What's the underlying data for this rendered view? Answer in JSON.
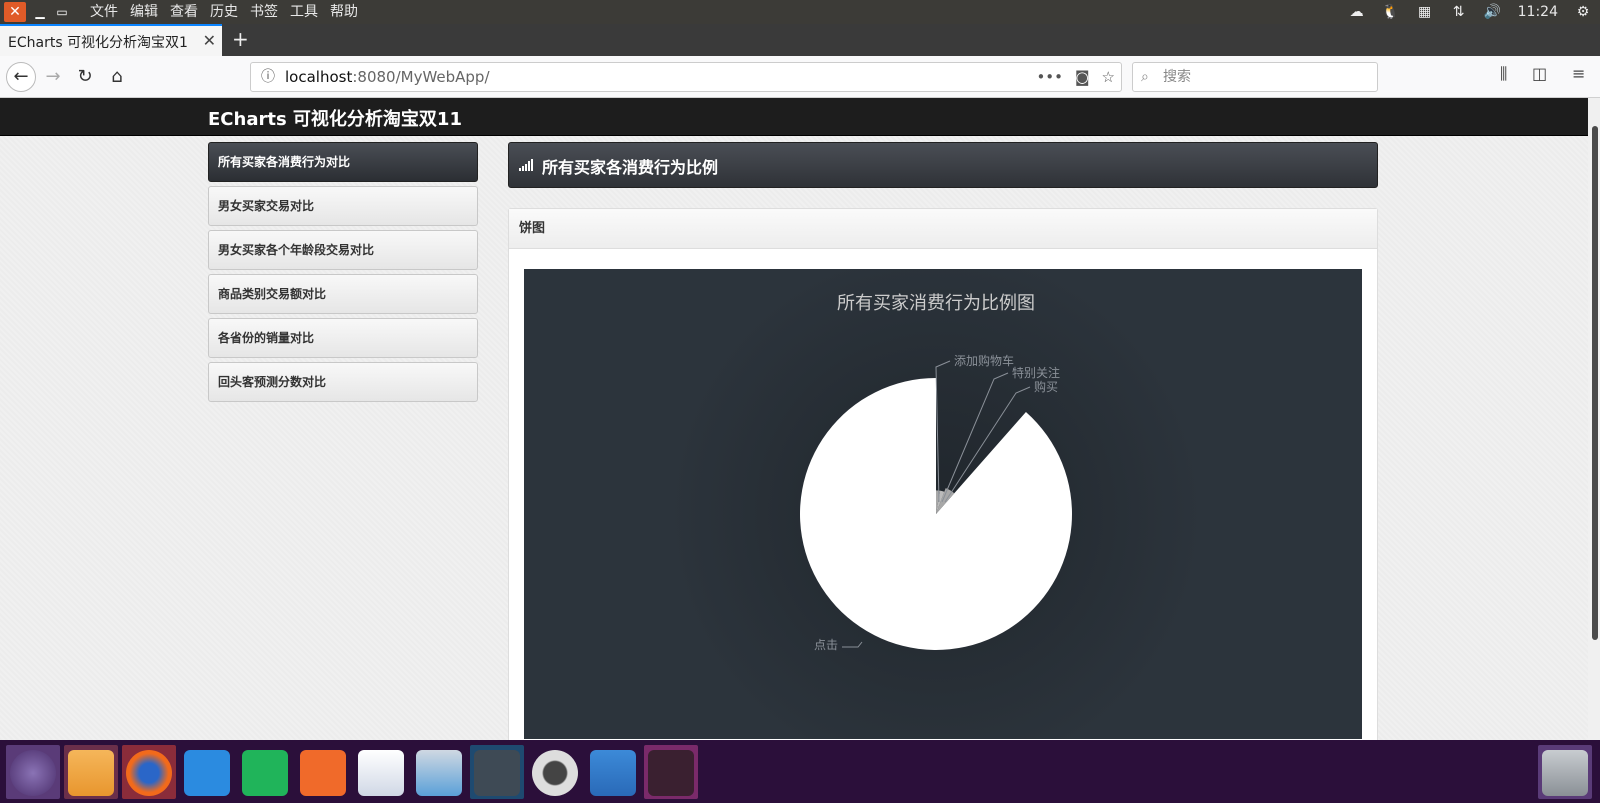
{
  "system": {
    "menu": [
      "文件",
      "编辑",
      "查看",
      "历史",
      "书签",
      "工具",
      "帮助"
    ],
    "clock": "11:24"
  },
  "browser": {
    "tab_title": "ECharts 可视化分析淘宝双1",
    "url_host": "localhost",
    "url_rest": ":8080/MyWebApp/",
    "search_placeholder": "搜索"
  },
  "site": {
    "title": "ECharts 可视化分析淘宝双11",
    "sidebar": [
      {
        "label": "所有买家各消费行为对比",
        "active": true
      },
      {
        "label": "男女买家交易对比",
        "active": false
      },
      {
        "label": "男女买家各个年龄段交易对比",
        "active": false
      },
      {
        "label": "商品类别交易额对比",
        "active": false
      },
      {
        "label": "各省份的销量对比",
        "active": false
      },
      {
        "label": "回头客预测分数对比",
        "active": false
      }
    ],
    "content_title": "所有买家各消费行为比例",
    "panel_title": "饼图"
  },
  "chart_data": {
    "type": "pie",
    "title": "所有买家消费行为比例图",
    "series": [
      {
        "name": "点击",
        "value": 88.5
      },
      {
        "name": "添加购物车",
        "value": 2.8
      },
      {
        "name": "特别关注",
        "value": 2.9
      },
      {
        "name": "购买",
        "value": 5.8
      }
    ],
    "colors": {
      "background": "#2c343c",
      "slice": "#ffffff",
      "label": "#8a9098"
    }
  },
  "dock": {
    "apps": [
      "ubuntu-dash",
      "files",
      "firefox",
      "wps-writer",
      "wps-spreadsheets",
      "wps-presentation",
      "ubuntu-kylin-store",
      "scanner",
      "vscode",
      "disk-utility",
      "workspace-switcher",
      "terminal",
      "trash"
    ]
  }
}
